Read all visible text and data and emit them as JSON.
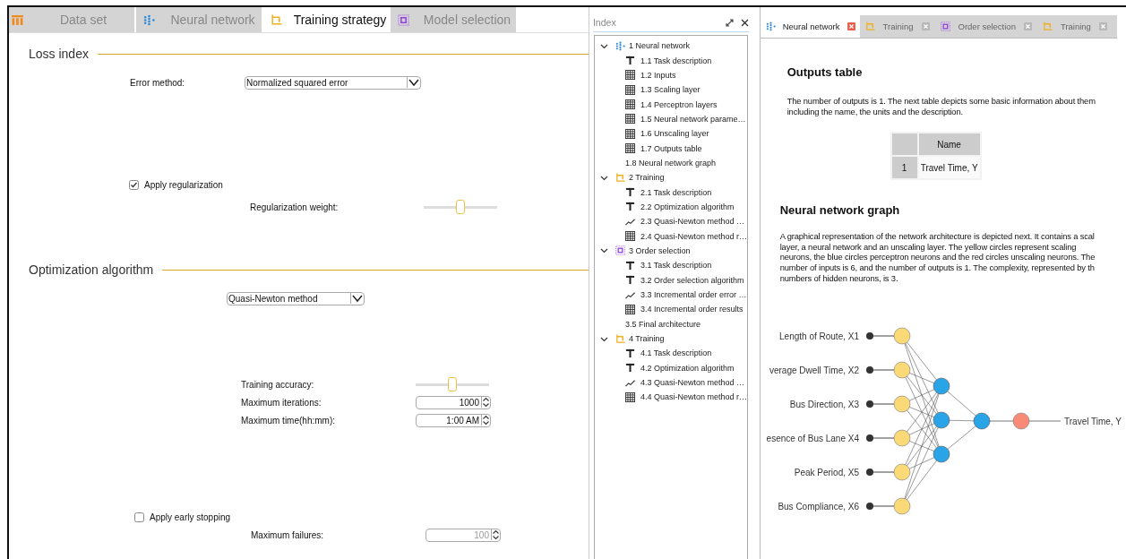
{
  "main_tabs": [
    {
      "label": "Data set",
      "kind": "dataset",
      "selected": false
    },
    {
      "label": "Neural network",
      "kind": "network",
      "selected": false
    },
    {
      "label": "Training strategy",
      "kind": "training",
      "selected": true
    },
    {
      "label": "Model selection",
      "kind": "selection",
      "selected": false
    }
  ],
  "loss_index": {
    "title": "Loss index",
    "error_method": {
      "label": "Error method:",
      "value": "Normalized squared error"
    },
    "regularization": {
      "label": "Apply regularization",
      "checked": true
    },
    "regularization_weight": {
      "label": "Regularization weight:",
      "level": 0.5
    }
  },
  "optimization": {
    "title": "Optimization algorithm",
    "method": {
      "value": "Quasi-Newton method"
    },
    "training_accuracy": {
      "label": "Training accuracy:",
      "level": 0.5
    },
    "maximum_iterations": {
      "label": "Maximum iterations:",
      "value": "1000",
      "disabled": false
    },
    "maximum_time": {
      "label": "Maximum time(hh:mm):",
      "value": "1:00 AM",
      "disabled": false
    },
    "early_stopping": {
      "label": "Apply early stopping",
      "checked": false
    },
    "maximum_failures": {
      "label": "Maximum failures:",
      "value": "100",
      "disabled": true
    }
  },
  "index": {
    "title": "Index",
    "items": [
      {
        "label": "1 Neural network",
        "kind": "network",
        "expanded": true,
        "children": [
          {
            "label": "1.1 Task description",
            "kind": "text"
          },
          {
            "label": "1.2 Inputs",
            "kind": "table"
          },
          {
            "label": "1.3 Scaling layer",
            "kind": "table"
          },
          {
            "label": "1.4 Perceptron layers",
            "kind": "table"
          },
          {
            "label": "1.5 Neural network parame…",
            "kind": "table"
          },
          {
            "label": "1.6 Unscaling layer",
            "kind": "table"
          },
          {
            "label": "1.7 Outputs table",
            "kind": "table"
          },
          {
            "label": "1.8 Neural network graph",
            "kind": "graph"
          }
        ]
      },
      {
        "label": "2 Training",
        "kind": "training",
        "expanded": true,
        "children": [
          {
            "label": "2.1 Task description",
            "kind": "text"
          },
          {
            "label": "2.2 Optimization algorithm",
            "kind": "text"
          },
          {
            "label": "2.3 Quasi-Newton method …",
            "kind": "chart"
          },
          {
            "label": "2.4 Quasi-Newton method r…",
            "kind": "table"
          }
        ]
      },
      {
        "label": "3 Order selection",
        "kind": "selection",
        "expanded": true,
        "children": [
          {
            "label": "3.1 Task description",
            "kind": "text"
          },
          {
            "label": "3.2 Order selection algorithm",
            "kind": "text"
          },
          {
            "label": "3.3 Incremental order error …",
            "kind": "chart"
          },
          {
            "label": "3.4 Incremental order results",
            "kind": "table"
          },
          {
            "label": "3.5 Final architecture",
            "kind": "graph"
          }
        ]
      },
      {
        "label": "4 Training",
        "kind": "training",
        "expanded": true,
        "children": [
          {
            "label": "4.1 Task description",
            "kind": "text"
          },
          {
            "label": "4.2 Optimization algorithm",
            "kind": "text"
          },
          {
            "label": "4.3 Quasi-Newton method …",
            "kind": "chart"
          },
          {
            "label": "4.4 Quasi-Newton method r…",
            "kind": "table"
          }
        ]
      }
    ]
  },
  "report_tabs": [
    {
      "label": "Neural network",
      "kind": "network",
      "selected": true
    },
    {
      "label": "Training",
      "kind": "training",
      "selected": false
    },
    {
      "label": "Order selection",
      "kind": "selection",
      "selected": false
    },
    {
      "label": "Training",
      "kind": "training",
      "selected": false
    }
  ],
  "report": {
    "outputs_title": "Outputs table",
    "outputs_text": "The number of outputs is 1. The next table depicts some basic information about them\nincluding the name, the units and the description.",
    "outputs_table": {
      "columns": [
        "Name"
      ],
      "rows": [
        {
          "number": "1",
          "name": "Travel Time, Y"
        }
      ]
    },
    "graph_title": "Neural network graph",
    "graph_text": "A graphical representation of the network architecture is depicted next. It contains a scal\nlayer, a neural network and an unscaling layer. The yellow circles represent scaling\nneurons, the blue circles perceptron neurons and the red circles unscaling neurons. The\nnumber of inputs is 6, and the number of outputs is 1. The complexity, represented by th\nnumbers of hidden neurons, is 3.",
    "graph": {
      "inputs": [
        "Length of Route, X1",
        "verage Dwell Time, X2",
        "Bus Direction, X3",
        "esence of Bus Lane X4",
        "Peak Period, X5",
        "Bus Compliance, X6"
      ],
      "output": "Travel Time, Y"
    }
  }
}
